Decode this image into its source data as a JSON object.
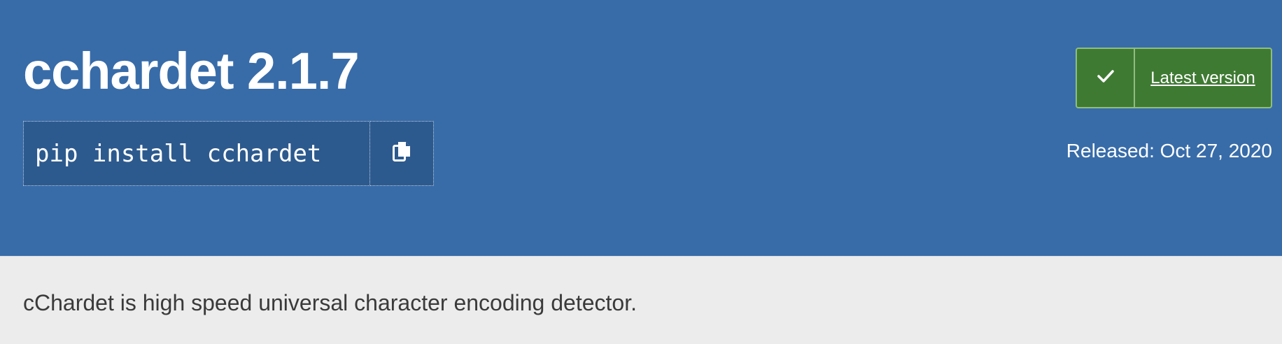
{
  "package": {
    "title": "cchardet 2.1.7",
    "install_command": "pip install cchardet",
    "copy_icon": "copy-icon",
    "latest_label": "Latest version",
    "check_icon": "check-icon",
    "released": "Released: Oct 27, 2020",
    "summary": "cChardet is high speed universal character encoding detector."
  },
  "colors": {
    "header_bg": "#386ca9",
    "pip_bg": "#2d5a8e",
    "badge_bg": "#3f7a33",
    "summary_bg": "#ececec"
  }
}
